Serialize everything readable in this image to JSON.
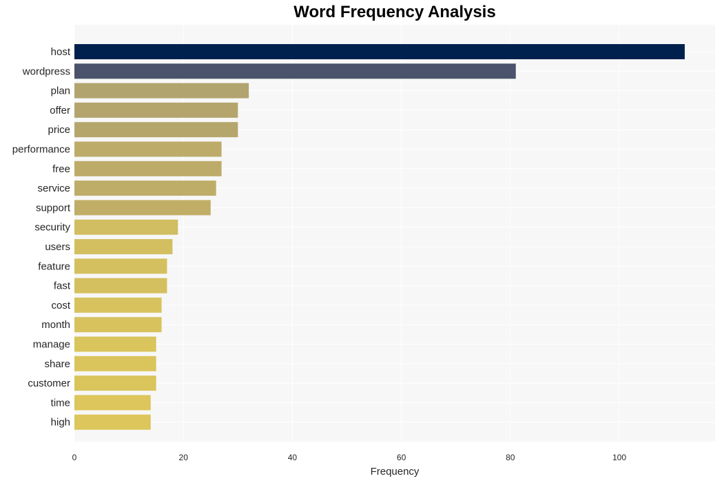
{
  "chart_data": {
    "type": "bar",
    "orientation": "horizontal",
    "title": "Word Frequency Analysis",
    "xlabel": "Frequency",
    "ylabel": "",
    "xlim": [
      0,
      117.6
    ],
    "xticks": [
      0,
      20,
      40,
      60,
      80,
      100
    ],
    "grid": true,
    "legend": "none",
    "categories": [
      "host",
      "wordpress",
      "plan",
      "offer",
      "price",
      "performance",
      "free",
      "service",
      "support",
      "security",
      "users",
      "feature",
      "fast",
      "cost",
      "month",
      "manage",
      "share",
      "customer",
      "time",
      "high"
    ],
    "values": [
      112,
      81,
      32,
      30,
      30,
      27,
      27,
      26,
      25,
      19,
      18,
      17,
      17,
      16,
      16,
      15,
      15,
      15,
      14,
      14
    ],
    "colors": [
      "#00204e",
      "#4a536b",
      "#b2a46e",
      "#b4a56d",
      "#b5a66c",
      "#bdab69",
      "#bdab69",
      "#bead68",
      "#c0ae67",
      "#d1bd62",
      "#d3bf60",
      "#d5c05f",
      "#d5c05f",
      "#d7c25e",
      "#d7c25e",
      "#dac45c",
      "#dac45c",
      "#dac45c",
      "#ddc65b",
      "#ddc65b"
    ]
  }
}
